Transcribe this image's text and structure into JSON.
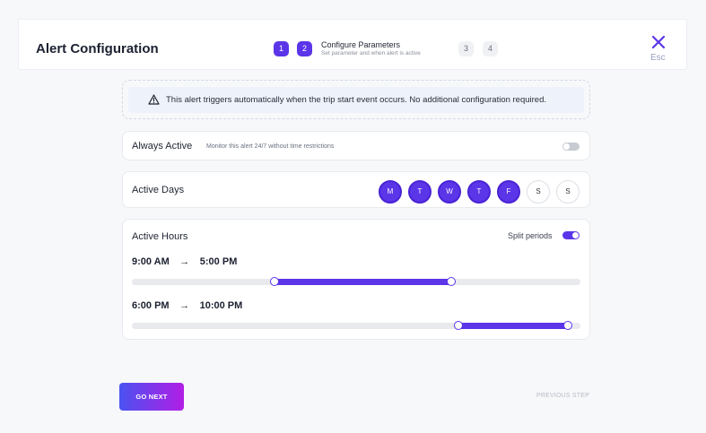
{
  "header": {
    "title": "Alert Configuration",
    "steps": [
      "1",
      "2",
      "3",
      "4"
    ],
    "current_step_label": "Configure Parameters",
    "current_step_sub": "Set parameter and when alert is active",
    "close_label": "Esc"
  },
  "notice": {
    "text": "This alert triggers automatically when the trip start event occurs. No additional configuration required."
  },
  "always_active": {
    "label": "Always Active",
    "description": "Monitor this alert 24/7 without time restrictions",
    "enabled": false
  },
  "active_days": {
    "label": "Active Days",
    "days": [
      {
        "label": "M",
        "selected": true
      },
      {
        "label": "T",
        "selected": true
      },
      {
        "label": "W",
        "selected": true
      },
      {
        "label": "T",
        "selected": true
      },
      {
        "label": "F",
        "selected": true
      },
      {
        "label": "S",
        "selected": false
      },
      {
        "label": "S",
        "selected": false
      }
    ]
  },
  "active_hours": {
    "label": "Active Hours",
    "split_label": "Split periods",
    "split_enabled": true,
    "arrow": "→",
    "periods": [
      {
        "start": "9:00 AM",
        "end": "5:00 PM",
        "start_fraction": 0.317,
        "end_fraction": 0.711
      },
      {
        "start": "6:00 PM",
        "end": "10:00 PM",
        "start_fraction": 0.728,
        "end_fraction": 0.971
      }
    ]
  },
  "footer": {
    "next_label": "GO NEXT",
    "prev_label": "PREVIOUS STEP"
  },
  "colors": {
    "accent": "#5b35e8",
    "gradient_start": "#4a52f0",
    "gradient_end": "#b21ee6"
  }
}
